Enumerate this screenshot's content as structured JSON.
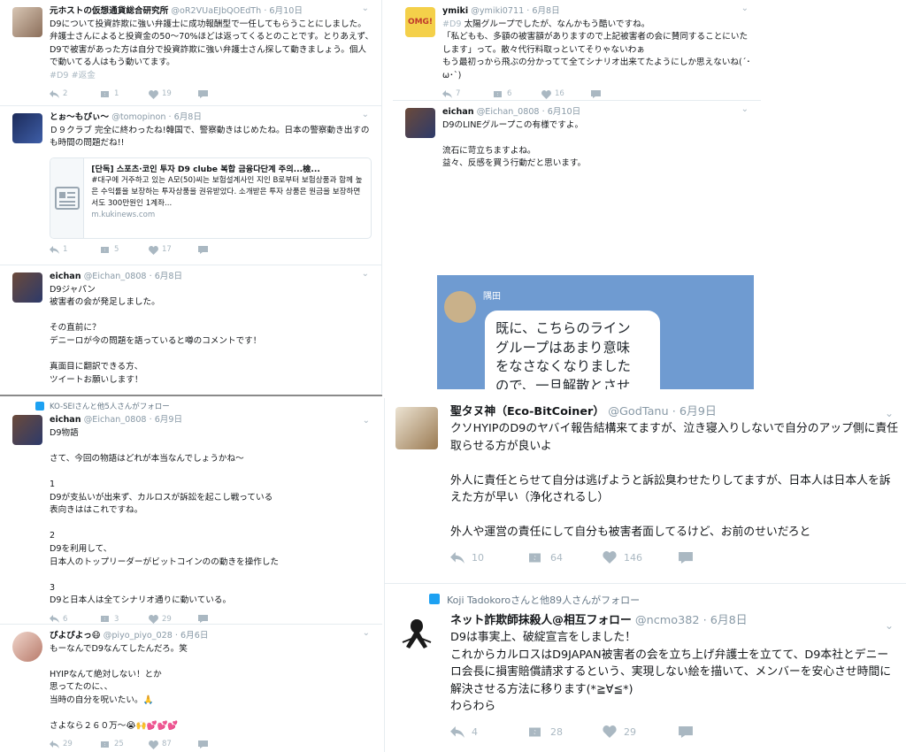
{
  "tl_panel": {
    "tweets": [
      {
        "name": "元ホストの仮想通貨総合研究所",
        "handle": "@oR2VUaEJbQOEdTh",
        "date": "· 6月10日",
        "text": "D9について投資詐欺に強い弁護士に成功報酬型で一任してもらうことにしました。弁護士さんによると投資金の50〜70%ほどは返ってくるとのことです。とりあえず、D9で被害があった方は自分で投資詐欺に強い弁護士さん探して動きましょう。個人で動いてる人はもう動いてます。",
        "tags": "#D9 #返金",
        "replies": "2",
        "retweets": "1",
        "likes": "19"
      },
      {
        "name": "とぉ〜もぴぃ〜",
        "handle": "@tomopinon",
        "date": "· 6月8日",
        "text": "Ｄ９クラブ 完全に終わったね!韓国で、警察動きはじめたね。日本の警察動き出すのも時間の問題だね!!",
        "card": {
          "title": "[단독] 스포츠·코인 투자 D9 clube 복합 금융다단계 주의...檢...",
          "desc": "#대구에 거주하고 있는 A모(50)씨는 보험설계사인 지인 B로부터 보험상품과 함께 높은 수익률을 보장하는 투자상품을 권유받았다. 소개받은 투자 상품은 원금을 보장하면서도 300만원인 1계좌...",
          "url": "m.kukinews.com"
        },
        "replies": "1",
        "retweets": "5",
        "likes": "17"
      },
      {
        "name": "eichan",
        "handle": "@Eichan_0808",
        "date": "· 6月8日",
        "text": "D9ジャパン\n被害者の会が発足しました。\n\nその直前に？\nデニーロが今の問題を語っていると噂のコメントです！\n\n真面目に翻訳できる方、\nツイートお願いします！"
      }
    ]
  },
  "tr_panel": {
    "tweets": [
      {
        "name": "ymiki",
        "handle": "@ymiki0711",
        "date": "· 6月8日",
        "tag": "#D9",
        "text": " 太陽グループでしたが、なんかもう酷いですね。\n「私どもも、多額の被害額がありますので上記被害者の会に賛同することにいたします」って。散々代行料取っといてそりゃないわぁ\nもう最初っから飛ぶの分かってて全てシナリオ出来てたようにしか思えないね(´･ω･`)",
        "replies": "7",
        "retweets": "6",
        "likes": "16"
      },
      {
        "name": "eichan",
        "handle": "@Eichan_0808",
        "date": "· 6月10日",
        "text": "D9のLINEグループこの有様ですよ。\n\n流石に苛立ちますよね。\n益々、反感を買う行動だと思います。",
        "line": {
          "sender": "隅田",
          "message": "既に、こちらのライン\nグループはあまり意味\nをなさなくなりました\nので、一旦解散とさせ\nて頂きます。\n\n今後は、リーダーに情\n報を個別発信させて頂\nきますのでそちらから"
        }
      }
    ]
  },
  "bl_panel": {
    "retweet_context": "KO-SEIさんと他5人さんがフォロー",
    "tweets": [
      {
        "name": "eichan",
        "handle": "@Eichan_0808",
        "date": "· 6月9日",
        "text": "D9物語\n\nさて、今回の物語はどれが本当なんでしょうかね〜\n\n1\nD9が支払いが出来ず、カルロスが訴訟を起こし戦っている\n表向きははこれですね。\n\n2\nD9を利用して、\n日本人のトップリーダーがビットコインのの動きを操作した\n\n3\nD9と日本人は全てシナリオ通りに動いている。",
        "replies": "6",
        "retweets": "3",
        "likes": "29"
      },
      {
        "name": "ぴよぴよっ😷",
        "handle": "@piyo_piyo_028",
        "date": "· 6月6日",
        "text": "もーなんでD9なんてしたんだろ。笑\n\nHYIPなんて絶対しない！とか\n思ってたのに、、\n当時の自分を呪いたい。🙏\n\nさよなら２６０万〜😭🙌💕💕💕",
        "replies": "29",
        "retweets": "25",
        "likes": "87"
      }
    ]
  },
  "br_panel": {
    "tweets": [
      {
        "name": "聖タヌ神（Eco-BitCoiner）",
        "handle": "@GodTanu",
        "date": "· 6月9日",
        "text": "クソHYIPのD9のヤバイ報告結構来てますが、泣き寝入りしないで自分のアップ側に責任取らせる方が良いよ\n\n外人に責任とらせて自分は逃げようと訴訟臭わせたりしてますが、日本人は日本人を訴えた方が早い（浄化されるし）\n\n外人や運営の責任にして自分も被害者面してるけど、お前のせいだろと",
        "replies": "10",
        "retweets": "64",
        "likes": "146"
      },
      {
        "retweet_context": "Koji Tadokoroさんと他89人さんがフォロー",
        "name": "ネット詐欺師抹殺人@相互フォロー",
        "handle": "@ncmo382",
        "date": "· 6月8日",
        "text": "D9は事実上、破綻宣言をしました！\nこれからカルロスはD9JAPAN被害者の会を立ち上げ弁護士を立てて、D9本社とデニーロ会長に損害賠償請求するという、実現しない絵を描いて、メンバーを安心させ時間に解決させる方法に移ります(*≧∀≦*)\nわらわら",
        "replies": "4",
        "retweets": "28",
        "likes": "29"
      }
    ]
  },
  "icons": {
    "reply": "reply-icon",
    "retweet": "retweet-icon",
    "like": "heart-icon",
    "dm": "message-icon",
    "chevron": "chevron-down-icon",
    "card_thumb": "article-icon"
  },
  "colors": {
    "meta": "#8899a6",
    "action": "#aab8c2",
    "line_bg": "#6f9bd1",
    "follow_icon": "#1da1f2"
  }
}
